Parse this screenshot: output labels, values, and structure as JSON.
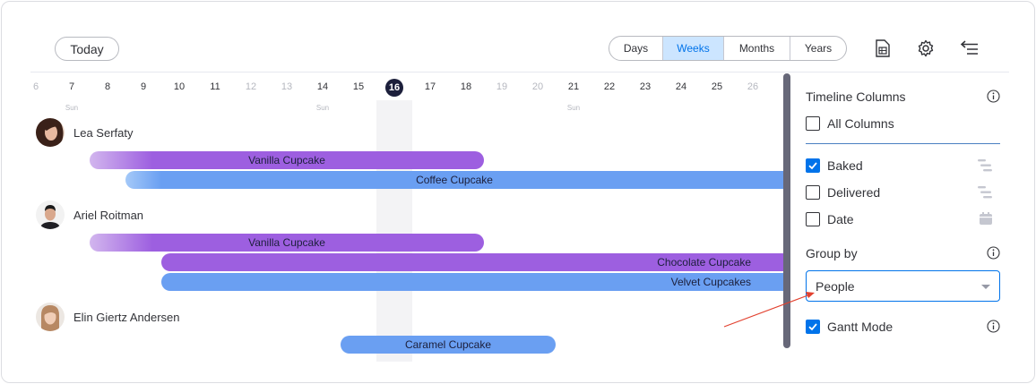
{
  "toolbar": {
    "today_label": "Today",
    "view_options": [
      {
        "label": "Days",
        "active": false
      },
      {
        "label": "Weeks",
        "active": true
      },
      {
        "label": "Months",
        "active": false
      },
      {
        "label": "Years",
        "active": false
      }
    ],
    "icons": [
      "spreadsheet-icon",
      "settings-gear-icon",
      "collapse-panel-icon"
    ]
  },
  "timeline": {
    "days": [
      {
        "label": "6",
        "dim": true
      },
      {
        "label": "7",
        "dim": false,
        "sun": true
      },
      {
        "label": "8",
        "dim": false
      },
      {
        "label": "9",
        "dim": false
      },
      {
        "label": "10",
        "dim": false
      },
      {
        "label": "11",
        "dim": false
      },
      {
        "label": "12",
        "dim": true
      },
      {
        "label": "13",
        "dim": true
      },
      {
        "label": "14",
        "dim": false,
        "sun": true
      },
      {
        "label": "15",
        "dim": false
      },
      {
        "label": "16",
        "dim": false,
        "today": true
      },
      {
        "label": "17",
        "dim": false
      },
      {
        "label": "18",
        "dim": false
      },
      {
        "label": "19",
        "dim": true
      },
      {
        "label": "20",
        "dim": true
      },
      {
        "label": "21",
        "dim": false,
        "sun": true
      },
      {
        "label": "22",
        "dim": false
      },
      {
        "label": "23",
        "dim": false
      },
      {
        "label": "24",
        "dim": false
      },
      {
        "label": "25",
        "dim": false
      },
      {
        "label": "26",
        "dim": true
      }
    ],
    "sun_label": "Sun"
  },
  "groups": [
    {
      "person": "Lea Serfaty",
      "items": [
        {
          "label": "Vanilla Cupcake",
          "color": "#9d5fe0",
          "start_day": "8",
          "end_day": "18"
        },
        {
          "label": "Coffee Cupcake",
          "color": "#6a9ff2",
          "start_day": "9",
          "end_day": "26+"
        }
      ]
    },
    {
      "person": "Ariel Roitman",
      "items": [
        {
          "label": "Vanilla Cupcake",
          "color": "#9d5fe0",
          "start_day": "8",
          "end_day": "18"
        },
        {
          "label": "Chocolate Cupcake",
          "color": "#9d5fe0",
          "start_day": "10",
          "end_day": "26+"
        },
        {
          "label": "Velvet Cupcakes",
          "color": "#6a9ff2",
          "start_day": "10",
          "end_day": "26+"
        }
      ]
    },
    {
      "person": "Elin Giertz Andersen",
      "items": [
        {
          "label": "Caramel Cupcake",
          "color": "#6a9ff2",
          "start_day": "15",
          "end_day": "21"
        }
      ]
    }
  ],
  "panel": {
    "timeline_columns_title": "Timeline Columns",
    "all_columns_label": "All Columns",
    "all_columns_checked": false,
    "columns": [
      {
        "label": "Baked",
        "checked": true,
        "icon": "timeline-column-icon"
      },
      {
        "label": "Delivered",
        "checked": false,
        "icon": "timeline-column-icon"
      },
      {
        "label": "Date",
        "checked": false,
        "icon": "calendar-icon"
      }
    ],
    "group_by_title": "Group by",
    "group_by_value": "People",
    "gantt_mode_label": "Gantt Mode",
    "gantt_mode_checked": true
  },
  "colors": {
    "accent": "#0073ea",
    "purple": "#9d5fe0",
    "blue": "#6a9ff2",
    "annotation": "#e2412f"
  }
}
